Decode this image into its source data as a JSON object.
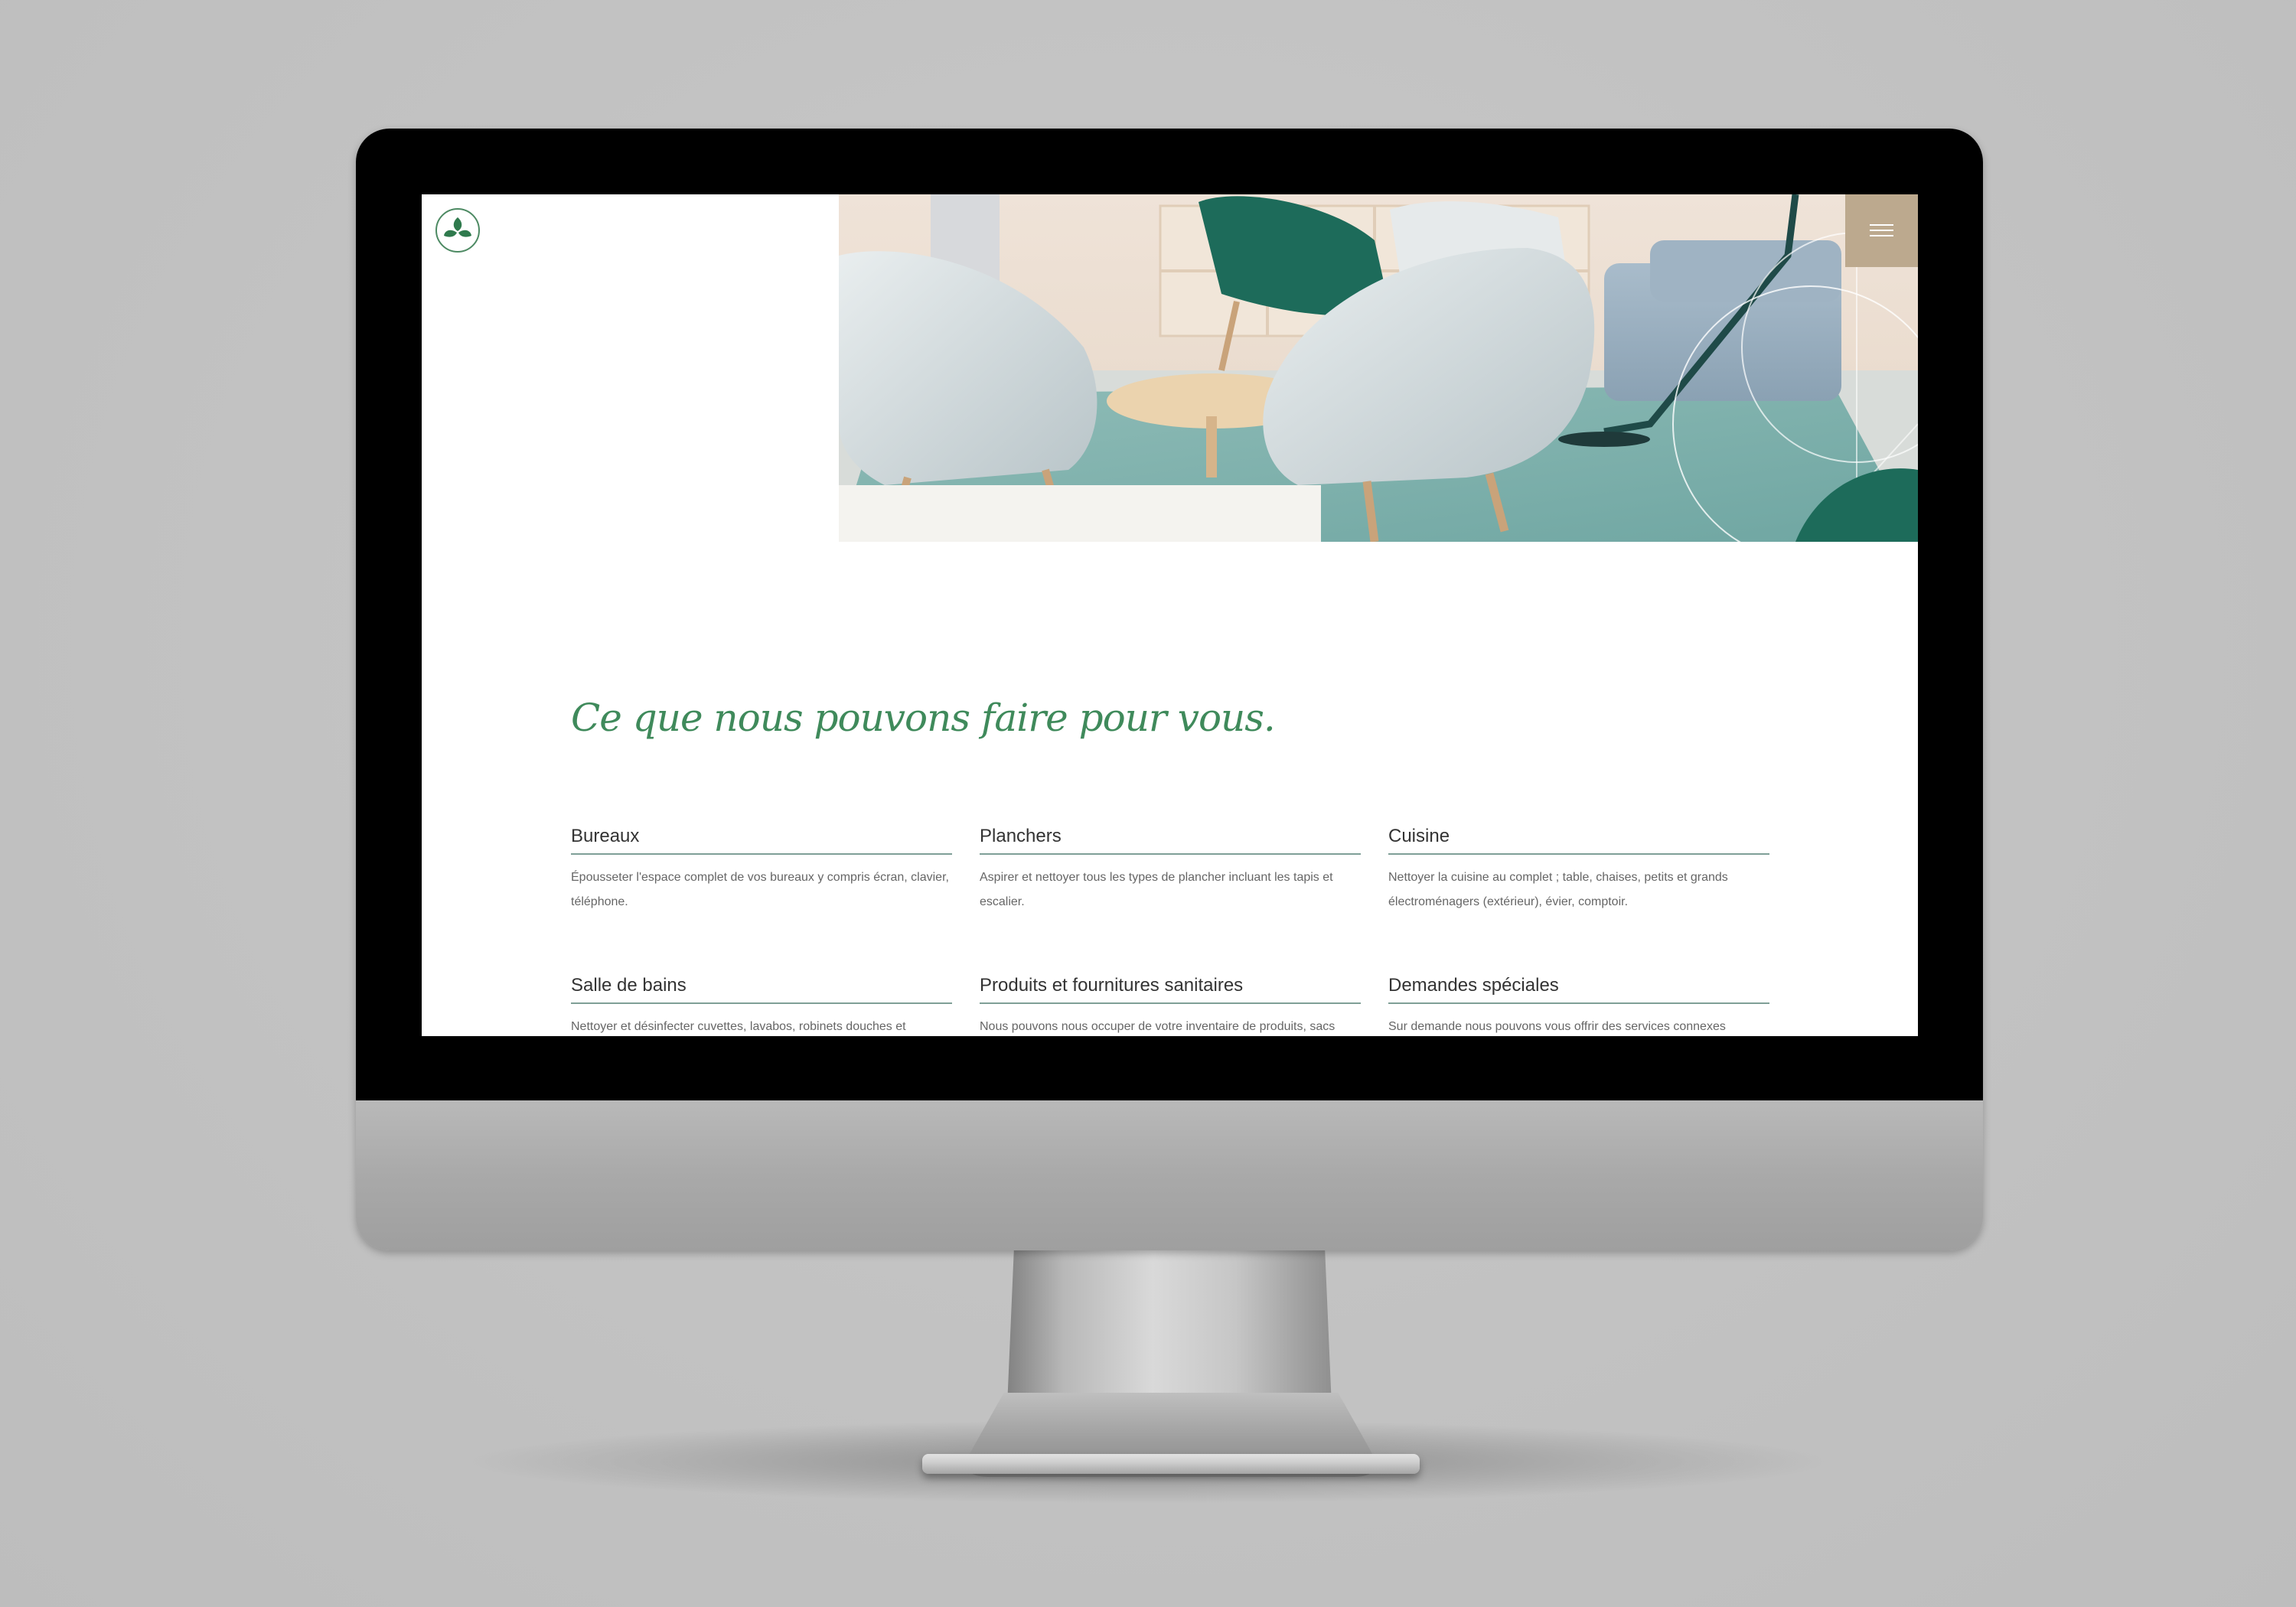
{
  "header": {
    "logo_icon": "leaf-logo-icon",
    "menu_icon": "hamburger-menu-icon",
    "menu_color": "#bca98e"
  },
  "hero": {
    "image_description": "interior with chairs",
    "accent_color": "#1d6b5a"
  },
  "services_section": {
    "heading": "Ce que nous pouvons faire pour vous.",
    "heading_color": "#3f8a5b",
    "items": [
      {
        "title": "Bureaux",
        "text": "Épousseter l'espace complet de vos bureaux y compris écran, clavier, téléphone."
      },
      {
        "title": "Planchers",
        "text": "Aspirer et nettoyer tous les types de plancher incluant les tapis et escalier."
      },
      {
        "title": "Cuisine",
        "text": "Nettoyer la cuisine au complet ; table, chaises, petits et grands électroménagers (extérieur), évier, comptoir."
      },
      {
        "title": "Salle de bains",
        "text": "Nettoyer et désinfecter cuvettes, lavabos, robinets douches et"
      },
      {
        "title": "Produits et fournitures sanitaires",
        "text": "Nous pouvons nous occuper de votre inventaire de produits, sacs"
      },
      {
        "title": "Demandes spéciales",
        "text": "Sur demande nous pouvons vous offrir des services connexes"
      }
    ]
  }
}
